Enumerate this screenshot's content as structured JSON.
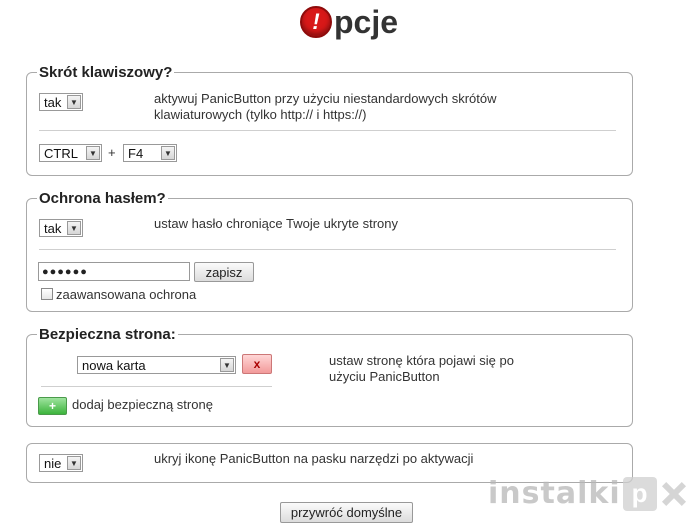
{
  "header": {
    "logo_letter": "!",
    "title": "pcje"
  },
  "section1": {
    "legend": "Skrót klawiszowy?",
    "toggle_value": "tak",
    "description": "aktywuj PanicButton przy użyciu niestandardowych skrótów klawiaturowych (tylko http:// i https://)",
    "modifier_value": "CTRL",
    "plus": "+",
    "key_value": "F4"
  },
  "section2": {
    "legend": "Ochrona hasłem?",
    "toggle_value": "tak",
    "description": "ustaw hasło chroniące Twoje ukryte strony",
    "password_mask": "●●●●●●",
    "save_label": "zapisz",
    "advanced_label": "zaawansowana ochrona",
    "advanced_checked": false
  },
  "section3": {
    "legend": "Bezpieczna strona:",
    "url_select_value": "nowa karta",
    "remove_label": "x",
    "description": "ustaw stronę która pojawi się po użyciu PanicButton",
    "add_label": "+",
    "add_text": "dodaj bezpieczną stronę"
  },
  "section4": {
    "toggle_value": "nie",
    "description": "ukryj ikonę PanicButton na pasku narzędzi po aktywacji"
  },
  "footer": {
    "reset_label": "przywróć domyślne"
  },
  "watermark": {
    "text": "instalki",
    "badge": "p"
  }
}
